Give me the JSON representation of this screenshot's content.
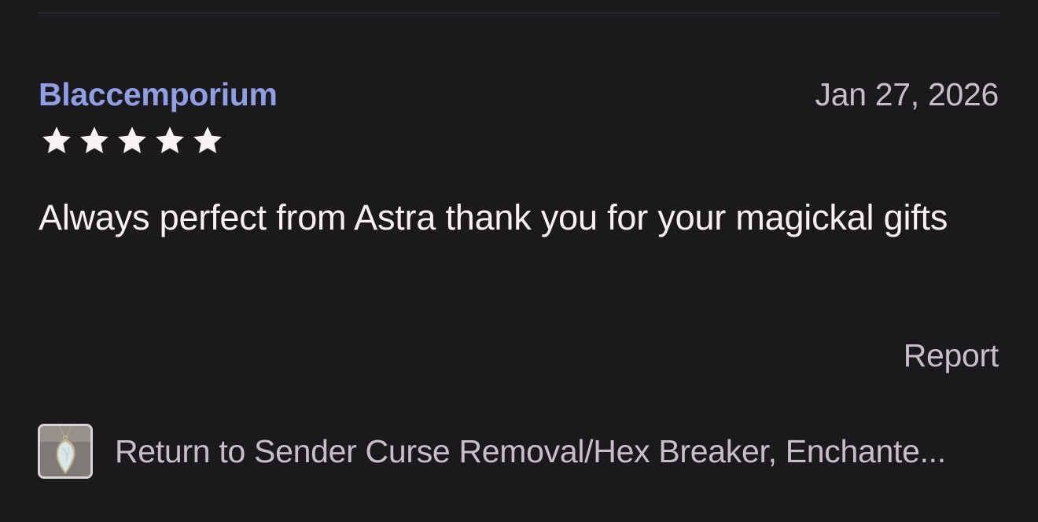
{
  "review": {
    "reviewer": "Blaccemporium",
    "date": "Jan 27, 2026",
    "rating": 5,
    "rating_max": 5,
    "text": "Always perfect from Astra thank you for your magickal gifts",
    "report_label": "Report"
  },
  "listing": {
    "title": "Return to Sender Curse Removal/Hex Breaker, Enchante...",
    "thumbnail": "pendant-image"
  },
  "colors": {
    "background": "#1c191d",
    "reviewer_link": "#8f9fe4",
    "star": "#f7f3f7",
    "primary_text": "#f5f1f5",
    "secondary_text": "#c5bfca"
  }
}
